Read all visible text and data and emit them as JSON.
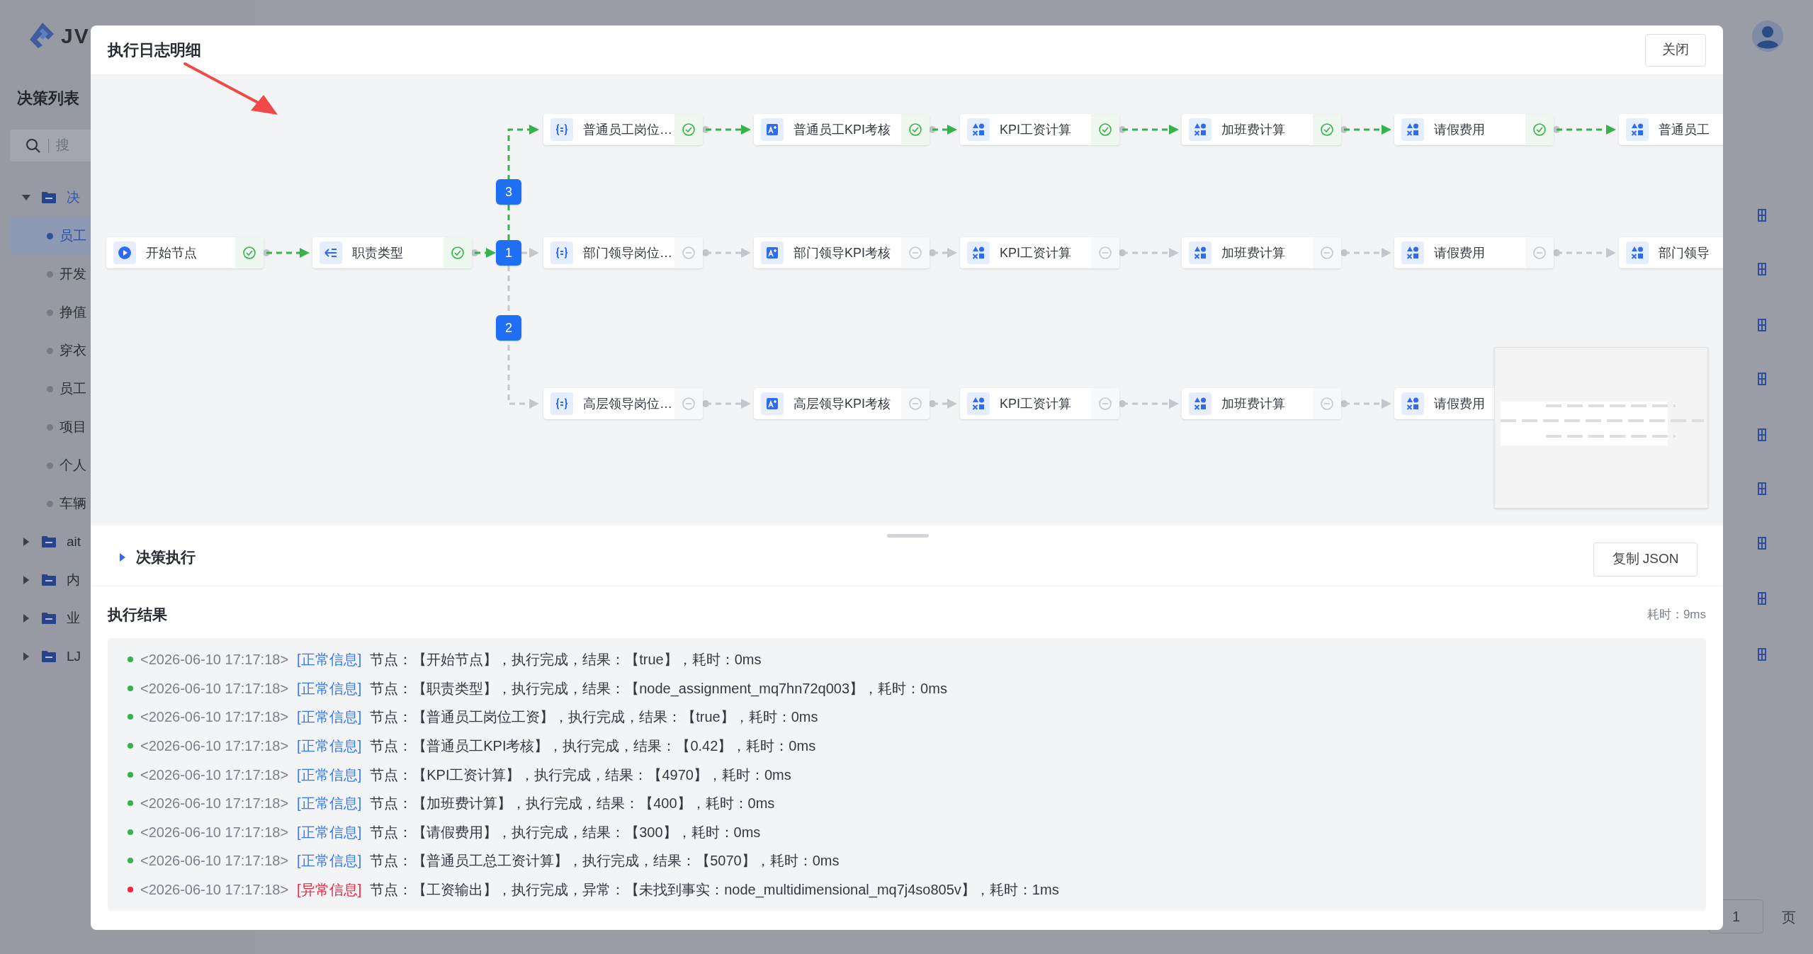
{
  "app": {
    "logo_text": "JV",
    "sidebar_title": "决策列表",
    "search_placeholder": "搜",
    "tree": [
      {
        "label": "决",
        "expanded": true,
        "children": [
          {
            "label": "员工",
            "selected": true
          },
          {
            "label": "开发",
            "selected": false
          },
          {
            "label": "挣值",
            "selected": false
          },
          {
            "label": "穿衣",
            "selected": false
          },
          {
            "label": "员工",
            "selected": false
          },
          {
            "label": "项目",
            "selected": false
          },
          {
            "label": "个人",
            "selected": false
          },
          {
            "label": "车辆",
            "selected": false
          }
        ]
      },
      {
        "label": "ait",
        "expanded": false
      },
      {
        "label": "内",
        "expanded": false
      },
      {
        "label": "业",
        "expanded": false
      },
      {
        "label": "LJ",
        "expanded": false
      }
    ],
    "pagination": {
      "page": "1",
      "suffix": "页"
    }
  },
  "dialog": {
    "title": "执行日志明细",
    "close_button": "关闭",
    "flow": {
      "head": [
        {
          "kind": "start",
          "label": "开始节点",
          "executed": true
        },
        {
          "kind": "switch",
          "label": "职责类型",
          "executed": true
        }
      ],
      "branches": [
        {
          "badge": "3",
          "nodes": [
            {
              "kind": "formula",
              "label": "普通员工岗位…",
              "executed": true
            },
            {
              "kind": "score",
              "label": "普通员工KPI考核",
              "executed": true
            },
            {
              "kind": "calc",
              "label": "KPI工资计算",
              "executed": true
            },
            {
              "kind": "calc",
              "label": "加班费计算",
              "executed": true
            },
            {
              "kind": "calc",
              "label": "请假费用",
              "executed": true
            },
            {
              "kind": "calc",
              "label": "普通员工"
            }
          ]
        },
        {
          "badge": "1",
          "nodes": [
            {
              "kind": "formula",
              "label": "部门领导岗位…",
              "executed": false
            },
            {
              "kind": "score",
              "label": "部门领导KPI考核",
              "executed": false
            },
            {
              "kind": "calc",
              "label": "KPI工资计算",
              "executed": false
            },
            {
              "kind": "calc",
              "label": "加班费计算",
              "executed": false
            },
            {
              "kind": "calc",
              "label": "请假费用",
              "executed": false
            },
            {
              "kind": "calc",
              "label": "部门领导"
            }
          ]
        },
        {
          "badge": "2",
          "nodes": [
            {
              "kind": "formula",
              "label": "高层领导岗位…",
              "executed": false
            },
            {
              "kind": "score",
              "label": "高层领导KPI考核",
              "executed": false
            },
            {
              "kind": "calc",
              "label": "KPI工资计算",
              "executed": false
            },
            {
              "kind": "calc",
              "label": "加班费计算",
              "executed": false
            },
            {
              "kind": "calc",
              "label": "请假费用"
            }
          ]
        }
      ]
    },
    "section_title": "决策执行",
    "copy_button": "复制 JSON",
    "result_title": "执行结果",
    "elapsed": "耗时：9ms",
    "logs": [
      {
        "error": false,
        "time": "<2026-06-10 17:17:18>",
        "tag": "[正常信息]",
        "message": "节点：【开始节点】，执行完成，结果：【true】，耗时：0ms"
      },
      {
        "error": false,
        "time": "<2026-06-10 17:17:18>",
        "tag": "[正常信息]",
        "message": "节点：【职责类型】，执行完成，结果：【node_assignment_mq7hn72q003】，耗时：0ms"
      },
      {
        "error": false,
        "time": "<2026-06-10 17:17:18>",
        "tag": "[正常信息]",
        "message": "节点：【普通员工岗位工资】，执行完成，结果：【true】，耗时：0ms"
      },
      {
        "error": false,
        "time": "<2026-06-10 17:17:18>",
        "tag": "[正常信息]",
        "message": "节点：【普通员工KPI考核】，执行完成，结果：【0.42】，耗时：0ms"
      },
      {
        "error": false,
        "time": "<2026-06-10 17:17:18>",
        "tag": "[正常信息]",
        "message": "节点：【KPI工资计算】，执行完成，结果：【4970】，耗时：0ms"
      },
      {
        "error": false,
        "time": "<2026-06-10 17:17:18>",
        "tag": "[正常信息]",
        "message": "节点：【加班费计算】，执行完成，结果：【400】，耗时：0ms"
      },
      {
        "error": false,
        "time": "<2026-06-10 17:17:18>",
        "tag": "[正常信息]",
        "message": "节点：【请假费用】，执行完成，结果：【300】，耗时：0ms"
      },
      {
        "error": false,
        "time": "<2026-06-10 17:17:18>",
        "tag": "[正常信息]",
        "message": "节点：【普通员工总工资计算】，执行完成，结果：【5070】，耗时：0ms"
      },
      {
        "error": true,
        "time": "<2026-06-10 17:17:18>",
        "tag": "[异常信息]",
        "message": "节点：【工资输出】，执行完成，异常：【未找到事实：node_multidimensional_mq7j4so805v】，耗时：1ms"
      }
    ]
  }
}
